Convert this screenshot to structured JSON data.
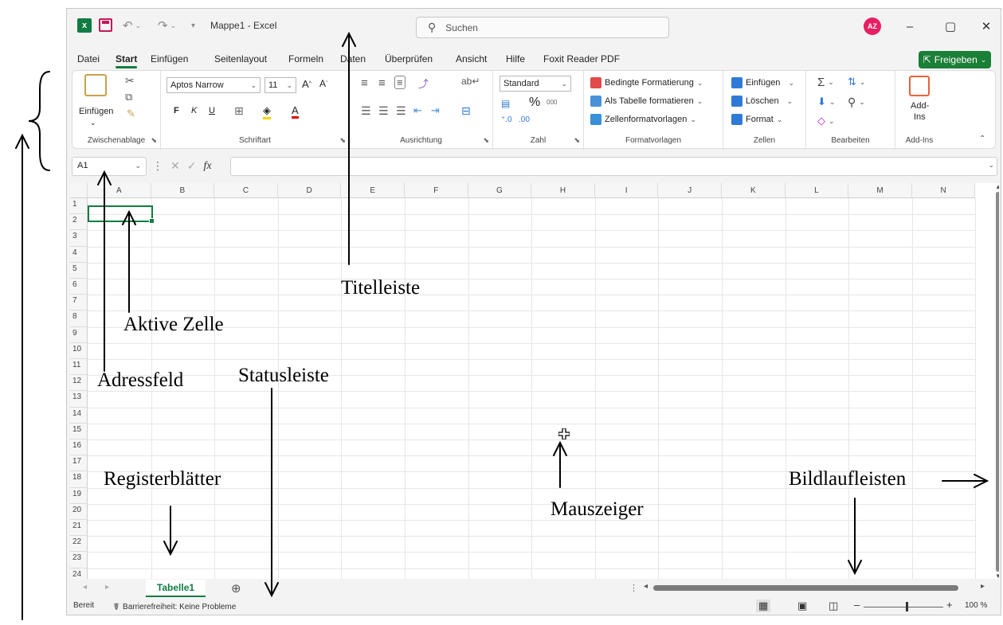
{
  "app": {
    "doc_title": "Mappe1 - Excel",
    "search_placeholder": "Suchen",
    "avatar_initials": "AZ",
    "window_controls": {
      "minimize": "–",
      "maximize": "▢",
      "close": "✕"
    }
  },
  "menu": {
    "items": [
      "Datei",
      "Start",
      "Einfügen",
      "Seitenlayout",
      "Formeln",
      "Daten",
      "Überprüfen",
      "Ansicht",
      "Hilfe",
      "Foxit Reader PDF"
    ],
    "active": "Start",
    "share_label": "Freigeben"
  },
  "ribbon": {
    "clipboard": {
      "paste_label": "Einfügen",
      "group_label": "Zwischenablage"
    },
    "font": {
      "font_name": "Aptos Narrow",
      "font_size": "11",
      "bold": "F",
      "italic": "K",
      "underline": "U",
      "group_label": "Schriftart"
    },
    "alignment": {
      "group_label": "Ausrichtung"
    },
    "number": {
      "format": "Standard",
      "percent": "%",
      "thousands": "000",
      "group_label": "Zahl"
    },
    "styles": {
      "conditional": "Bedingte Formatierung",
      "as_table": "Als Tabelle formatieren",
      "cell_styles": "Zellenformatvorlagen",
      "group_label": "Formatvorlagen"
    },
    "cells": {
      "insert": "Einfügen",
      "delete": "Löschen",
      "format": "Format",
      "group_label": "Zellen"
    },
    "editing": {
      "group_label": "Bearbeiten"
    },
    "addins": {
      "label_line1": "Add-",
      "label_line2": "Ins",
      "group_label": "Add-Ins"
    }
  },
  "formula_bar": {
    "name_box": "A1",
    "fx": "fx",
    "value": ""
  },
  "sheet": {
    "columns": [
      "A",
      "B",
      "C",
      "D",
      "E",
      "F",
      "G",
      "H",
      "I",
      "J",
      "K",
      "L",
      "M",
      "N"
    ],
    "rows": [
      "1",
      "2",
      "3",
      "4",
      "5",
      "6",
      "7",
      "8",
      "9",
      "10",
      "11",
      "12",
      "13",
      "14",
      "15",
      "16",
      "17",
      "18",
      "19",
      "20",
      "21",
      "22",
      "23",
      "24"
    ],
    "active_cell": "A1"
  },
  "tabs": {
    "sheet_name": "Tabelle1",
    "add_sheet": "⊕"
  },
  "status": {
    "ready": "Bereit",
    "accessibility": "Barrierefreiheit: Keine Probleme",
    "zoom_minus": "–",
    "zoom_plus": "+",
    "zoom": "100 %"
  },
  "annotations": {
    "titelleiste": "Titelleiste",
    "aktive_zelle": "Aktive Zelle",
    "adressfeld": "Adressfeld",
    "statusleiste": "Statusleiste",
    "registerblaetter": "Registerblätter",
    "mauszeiger": "Mauszeiger",
    "bildlaufleisten": "Bildlaufleisten"
  },
  "colors": {
    "excel_green": "#107c41",
    "avatar": "#e81e63",
    "share": "#1a7f37"
  }
}
